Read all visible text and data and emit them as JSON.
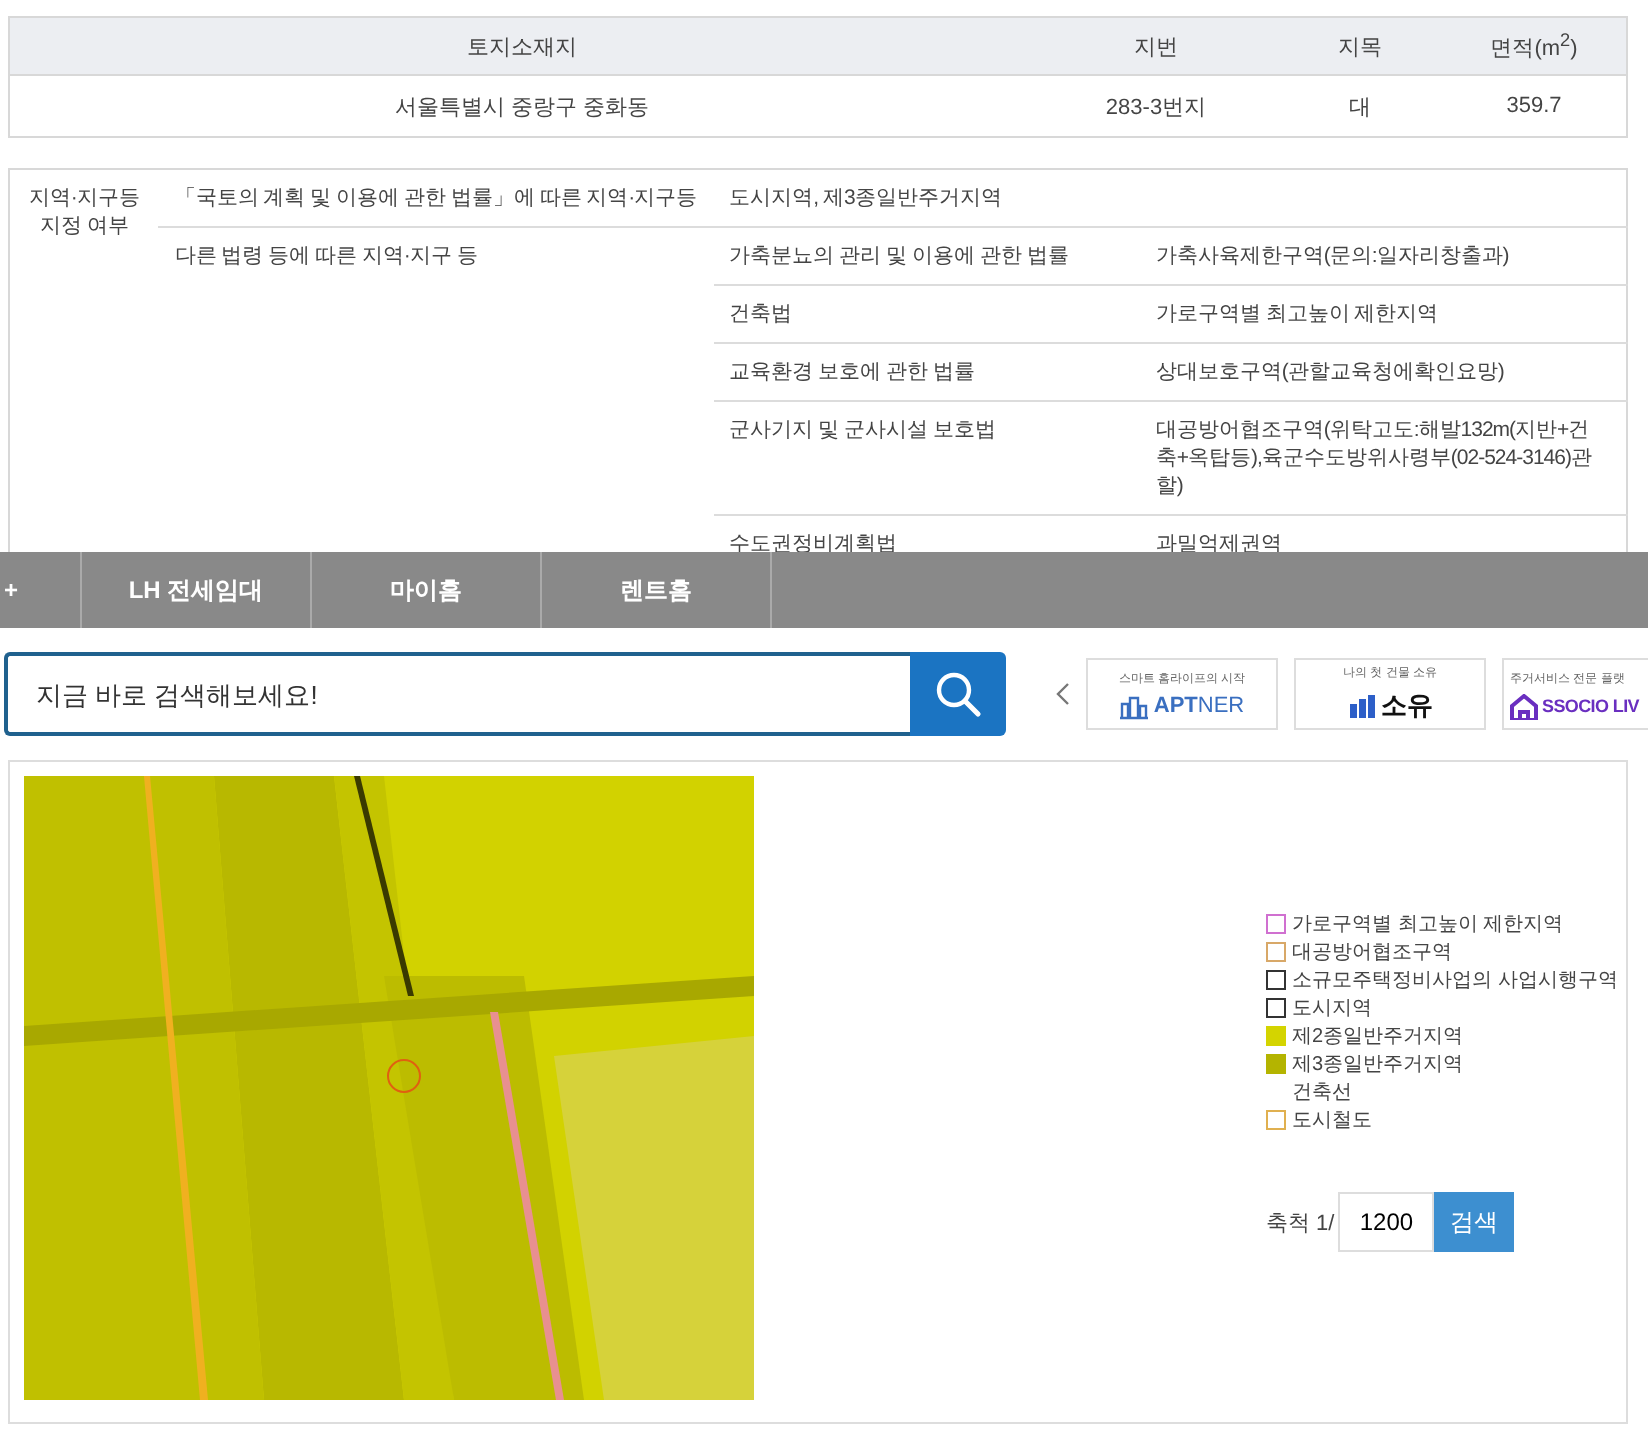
{
  "parcel_table": {
    "columns": [
      "토지소재지",
      "지번",
      "지목",
      "면적(m$^{2}$)"
    ],
    "rows": [
      [
        "서울특별시 중랑구 중화동",
        "283-3번지",
        "대",
        "359.7"
      ]
    ]
  },
  "zoning_table": {
    "heading": "지역·지구등 지정 여부",
    "national_law": {
      "law": "「국토의 계획 및 이용에 관한 법률」에 따른 지역·지구등",
      "zones": "도시지역, 제3종일반주거지역"
    },
    "other_laws": {
      "label": "다른 법령 등에 따른 지역·지구 등",
      "rows": [
        {
          "law": "가축분뇨의 관리 및 이용에 관한 법률",
          "zone": "가축사육제한구역(문의:일자리창출과)"
        },
        {
          "law": "건축법",
          "zone": "가로구역별 최고높이 제한지역"
        },
        {
          "law": "교육환경 보호에 관한 법률",
          "zone": "상대보호구역(관할교육청에확인요망)"
        },
        {
          "law": "군사기지 및 군사시설 보호법",
          "zone": "대공방어협조구역(위탁고도:해발132m(지반+건축+옥탑등),육군수도방위사령부(02-524-3146)관할)"
        },
        {
          "law": "수도권정비계획법",
          "zone": "과밀억제권역"
        }
      ]
    }
  },
  "nav": {
    "items": [
      "+",
      "LH 전세임대",
      "마이홈",
      "렌트홈"
    ]
  },
  "search": {
    "placeholder": "지금 바로 검색해보세요!"
  },
  "partners": [
    {
      "kind": "buildings",
      "caption": "스마트 홈라이프의 시작",
      "name": "**APT**NER"
    },
    {
      "kind": "bars",
      "caption": "나의 첫 건물 소유",
      "name": "소유"
    },
    {
      "kind": "house",
      "caption": "주거서비스 전문 플랫",
      "name": "SSOCIO LIV"
    }
  ],
  "map": {
    "legend": [
      {
        "kind": "outline",
        "color": "#d070d0",
        "label": "가로구역별 최고높이 제한지역"
      },
      {
        "kind": "outline",
        "color": "#d8a868",
        "label": "대공방어협조구역"
      },
      {
        "kind": "outline",
        "color": "#333333",
        "label": "소규모주택정비사업의 사업시행구역"
      },
      {
        "kind": "outline",
        "color": "#333333",
        "label": "도시지역"
      },
      {
        "kind": "fill",
        "color": "#d4d400",
        "label": "제2종일반주거지역"
      },
      {
        "kind": "fill",
        "color": "#b4b400",
        "label": "제3종일반주거지역"
      },
      {
        "kind": "none",
        "label": "건축선"
      },
      {
        "kind": "outline",
        "color": "#e0b050",
        "label": "도시철도"
      }
    ],
    "scale": {
      "label": "축척 1/",
      "value": "1200",
      "button": "검색"
    }
  }
}
